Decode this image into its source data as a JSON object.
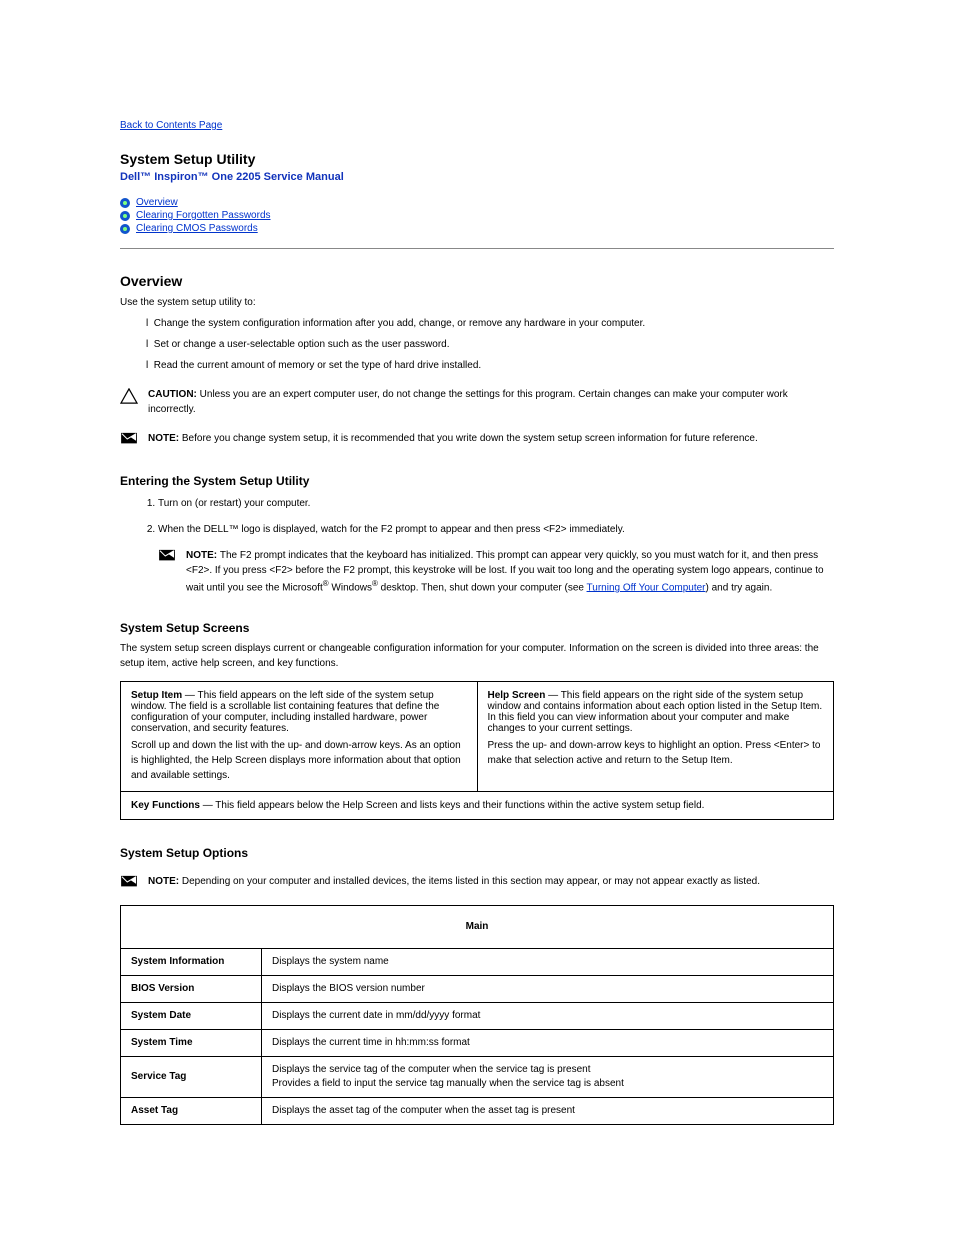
{
  "back_link": "Back to Contents Page",
  "manual_title": "Dell™ Inspiron™ One 2205 Service Manual",
  "doc_title": "System Setup Utility",
  "topics": [
    {
      "label": "Overview"
    },
    {
      "label": "Clearing Forgotten Passwords"
    },
    {
      "label": "Clearing CMOS Passwords"
    }
  ],
  "overview": {
    "heading": "Overview",
    "intro": "Use the system setup utility to:",
    "bullets": [
      "Change the system configuration information after you add, change, or remove any hardware in your computer.",
      "Set or change a user-selectable option such as the user password.",
      "Read the current amount of memory or set the type of hard drive installed."
    ],
    "caution_label": "CAUTION: ",
    "caution_text": "Unless you are an expert computer user, do not change the settings for this program. Certain changes can make your computer work incorrectly.",
    "note_label": "NOTE: ",
    "note_text": "Before you change system setup, it is recommended that you write down the system setup screen information for future reference."
  },
  "entering": {
    "heading": "Entering the System Setup Utility",
    "step1": "Turn on (or restart) your computer.",
    "step2_intro": "When the DELL™ logo is displayed, watch for the F2 prompt to appear and then press <F2> immediately.",
    "inner_note_label": "NOTE: ",
    "inner_note_text1": "The F2 prompt indicates that the keyboard has initialized. This prompt can appear very quickly, so you must watch for it, and then press <F2>. If you press <F2> before the F2 prompt, this keystroke will be lost. If you wait too long and the operating system logo appears, continue to wait until you see the Microsoft",
    "inner_note_text2": " Windows",
    "inner_note_text3": " desktop. Then, shut down your computer (see ",
    "inner_note_link": "Turning Off Your Computer",
    "inner_note_text4": ") and try again.",
    "reg": "®"
  },
  "screens": {
    "heading": "System Setup Screens",
    "intro": "The system setup screen displays current or changeable configuration information for your computer. Information on the screen is divided into three areas: the setup item, active help screen, and key functions.",
    "cells": [
      {
        "title_pre": "Setup Item ",
        "dash": "—",
        "title_post": " This field appears on the left side of the system setup window. The field is a scrollable list containing features that define the configuration of your computer, including installed hardware, power conservation, and security features.",
        "desc": "Scroll up and down the list with the up- and down-arrow keys. As an option is highlighted, the Help Screen displays more information about that option and available settings."
      },
      {
        "title_pre": "Help Screen ",
        "dash": "—",
        "title_post": " This field appears on the right side of the system setup window and contains information about each option listed in the Setup Item. In this field you can view information about your computer and make changes to your current settings.",
        "desc": "Press the up- and down-arrow keys to highlight an option. Press <Enter> to make that selection active and return to the Setup Item."
      },
      {
        "title_pre": "Key Functions ",
        "dash": "—",
        "title_post": " This field appears below the Help Screen and lists keys and their functions within the active system setup field.",
        "desc": ""
      }
    ]
  },
  "options": {
    "heading": "System Setup Options",
    "note_label": "NOTE: ",
    "note_text": "Depending on your computer and installed devices, the items listed in this section may appear, or may not appear exactly as listed.",
    "main_header": "Main",
    "rows": [
      {
        "k": "System Information",
        "v": "Displays the system name"
      },
      {
        "k": "BIOS Version",
        "v": "Displays the BIOS version number"
      },
      {
        "k": "System Date",
        "v": "Displays the current date in mm/dd/yyyy format"
      },
      {
        "k": "System Time",
        "v": "Displays the current time in hh:mm:ss format"
      },
      {
        "k": "Service Tag",
        "v": "Displays the service tag of the computer when the service tag is present\nProvides a field to input the service tag manually when the service tag is absent"
      },
      {
        "k": "Asset Tag",
        "v": "Displays the asset tag of the computer when the asset tag is present"
      }
    ]
  }
}
